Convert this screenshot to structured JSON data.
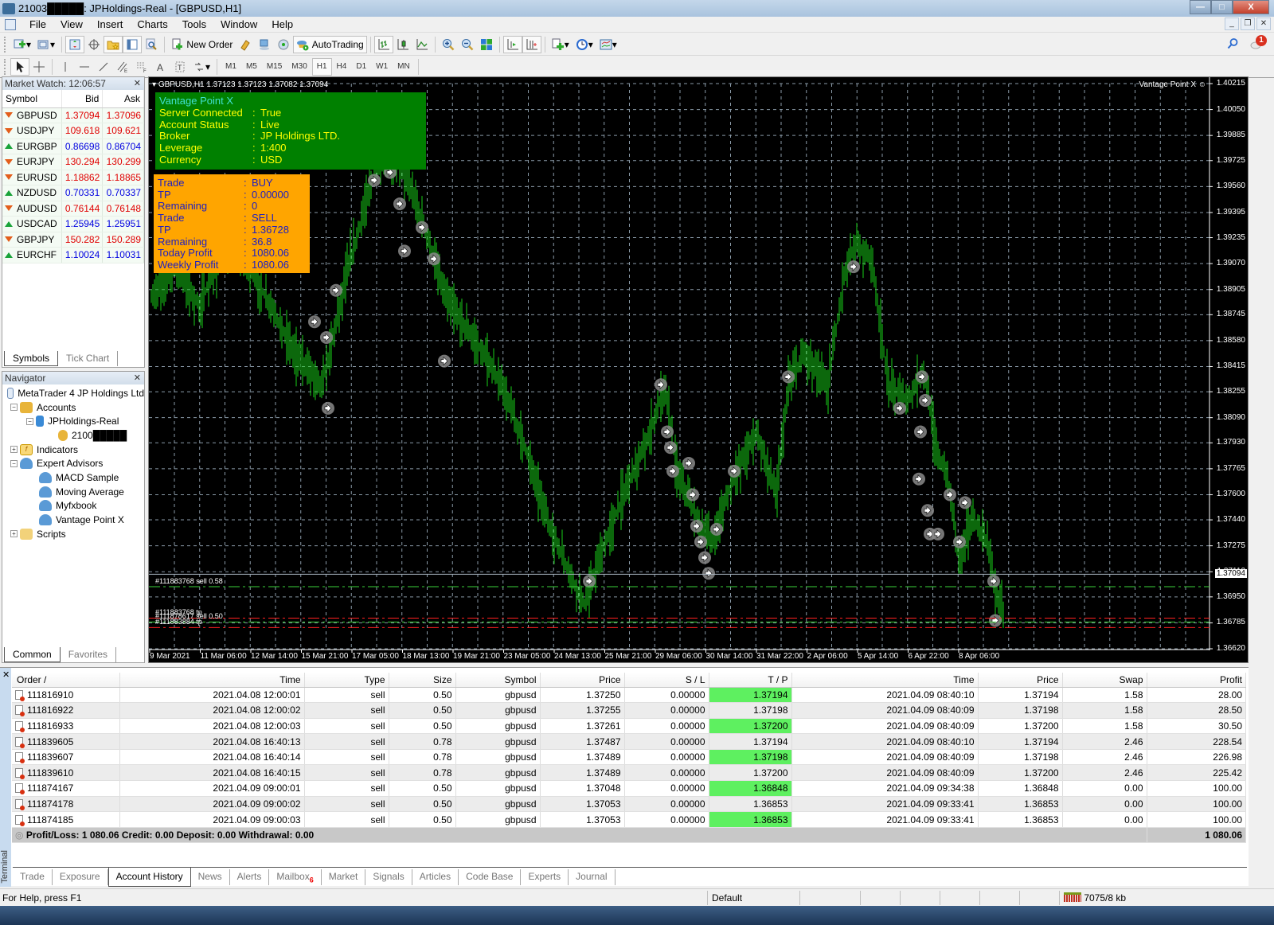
{
  "window": {
    "title": "21003█████: JPHoldings-Real - [GBPUSD,H1]",
    "controls": {
      "minimize": "—",
      "maximize": "□",
      "close": "X"
    }
  },
  "menu": [
    "File",
    "View",
    "Insert",
    "Charts",
    "Tools",
    "Window",
    "Help"
  ],
  "toolbar": {
    "new_order": "New Order",
    "autotrading": "AutoTrading",
    "timeframes": [
      "M1",
      "M5",
      "M15",
      "M30",
      "H1",
      "H4",
      "D1",
      "W1",
      "MN"
    ],
    "active_timeframe": "H1",
    "notification_count": "1"
  },
  "market_watch": {
    "title": "Market Watch: 12:06:57",
    "columns": [
      "Symbol",
      "Bid",
      "Ask"
    ],
    "rows": [
      {
        "symbol": "GBPUSD",
        "bid": "1.37094",
        "ask": "1.37096",
        "dir": "down"
      },
      {
        "symbol": "USDJPY",
        "bid": "109.618",
        "ask": "109.621",
        "dir": "down"
      },
      {
        "symbol": "EURGBP",
        "bid": "0.86698",
        "ask": "0.86704",
        "dir": "up"
      },
      {
        "symbol": "EURJPY",
        "bid": "130.294",
        "ask": "130.299",
        "dir": "down"
      },
      {
        "symbol": "EURUSD",
        "bid": "1.18862",
        "ask": "1.18865",
        "dir": "down"
      },
      {
        "symbol": "NZDUSD",
        "bid": "0.70331",
        "ask": "0.70337",
        "dir": "up"
      },
      {
        "symbol": "AUDUSD",
        "bid": "0.76144",
        "ask": "0.76148",
        "dir": "down"
      },
      {
        "symbol": "USDCAD",
        "bid": "1.25945",
        "ask": "1.25951",
        "dir": "up"
      },
      {
        "symbol": "GBPJPY",
        "bid": "150.282",
        "ask": "150.289",
        "dir": "down"
      },
      {
        "symbol": "EURCHF",
        "bid": "1.10024",
        "ask": "1.10031",
        "dir": "up"
      }
    ],
    "tabs": [
      "Symbols",
      "Tick Chart"
    ]
  },
  "navigator": {
    "title": "Navigator",
    "root": "MetaTrader 4 JP Holdings Ltd",
    "accounts": "Accounts",
    "server": "JPHoldings-Real",
    "account": "2100█████",
    "indicators": "Indicators",
    "expert_advisors": "Expert Advisors",
    "experts": [
      "MACD Sample",
      "Moving Average",
      "Myfxbook",
      "Vantage Point X"
    ],
    "scripts": "Scripts",
    "tabs": [
      "Common",
      "Favorites"
    ]
  },
  "chart": {
    "header": "GBPUSD,H1  1.37123 1.37123 1.37082 1.37094",
    "ea_name": "Vantage Point X",
    "current_price": "1.37094",
    "price_levels": [
      "1.40215",
      "1.40050",
      "1.39885",
      "1.39725",
      "1.39560",
      "1.39395",
      "1.39235",
      "1.39070",
      "1.38905",
      "1.38745",
      "1.38580",
      "1.38415",
      "1.38255",
      "1.38090",
      "1.37930",
      "1.37765",
      "1.37600",
      "1.37440",
      "1.37275",
      "1.37110",
      "1.36950",
      "1.36785",
      "1.36620"
    ],
    "time_labels": [
      "9 Mar 2021",
      "11 Mar 06:00",
      "12 Mar 14:00",
      "15 Mar 21:00",
      "17 Mar 05:00",
      "18 Mar 13:00",
      "19 Mar 21:00",
      "23 Mar 05:00",
      "24 Mar 13:00",
      "25 Mar 21:00",
      "29 Mar 06:00",
      "30 Mar 14:00",
      "31 Mar 22:00",
      "2 Apr 06:00",
      "5 Apr 14:00",
      "6 Apr 22:00",
      "8 Apr 06:00"
    ],
    "order_lines": [
      {
        "label": "#111883768 sell 0.58",
        "price": 1.37015,
        "color": "#3ad23a"
      },
      {
        "label": "#111883768 tp",
        "price": 1.36815,
        "color": "#ff2020"
      },
      {
        "label": "#111878617 sell 0.50",
        "price": 1.3679,
        "color": "#3ad23a"
      },
      {
        "label": "#111883884 tp",
        "price": 1.36755,
        "color": "#ff2020"
      }
    ],
    "colors": {
      "bars": "#19d119",
      "grid": "#8a9aa8",
      "background": "#000000"
    }
  },
  "panel_status": {
    "title": "Vantage Point X",
    "rows": [
      {
        "k": "Server Connected",
        "v": "True"
      },
      {
        "k": "Account Status",
        "v": "Live"
      },
      {
        "k": "Broker",
        "v": "JP Holdings LTD."
      },
      {
        "k": "Leverage",
        "v": "1:400"
      },
      {
        "k": "Currency",
        "v": "USD"
      }
    ]
  },
  "panel_trade": {
    "rows": [
      {
        "k": "Trade",
        "v": "BUY"
      },
      {
        "k": "TP",
        "v": "0.00000"
      },
      {
        "k": "Remaining",
        "v": "0"
      },
      {
        "k": "Trade",
        "v": "SELL"
      },
      {
        "k": "TP",
        "v": "1.36728"
      },
      {
        "k": "Remaining",
        "v": "36.8"
      },
      {
        "k": "Today Profit",
        "v": "1080.06"
      },
      {
        "k": "Weekly Profit",
        "v": "1080.06"
      }
    ]
  },
  "terminal": {
    "side_label": "Terminal",
    "columns": [
      "Order  /",
      "Time",
      "Type",
      "Size",
      "Symbol",
      "Price",
      "S / L",
      "T / P",
      "Time",
      "Price",
      "Swap",
      "Profit"
    ],
    "rows": [
      [
        "111816910",
        "2021.04.08 12:00:01",
        "sell",
        "0.50",
        "gbpusd",
        "1.37250",
        "0.00000",
        "1.37194",
        "2021.04.09 08:40:10",
        "1.37194",
        "1.58",
        "28.00"
      ],
      [
        "111816922",
        "2021.04.08 12:00:02",
        "sell",
        "0.50",
        "gbpusd",
        "1.37255",
        "0.00000",
        "1.37198",
        "2021.04.09 08:40:09",
        "1.37198",
        "1.58",
        "28.50"
      ],
      [
        "111816933",
        "2021.04.08 12:00:03",
        "sell",
        "0.50",
        "gbpusd",
        "1.37261",
        "0.00000",
        "1.37200",
        "2021.04.09 08:40:09",
        "1.37200",
        "1.58",
        "30.50"
      ],
      [
        "111839605",
        "2021.04.08 16:40:13",
        "sell",
        "0.78",
        "gbpusd",
        "1.37487",
        "0.00000",
        "1.37194",
        "2021.04.09 08:40:10",
        "1.37194",
        "2.46",
        "228.54"
      ],
      [
        "111839607",
        "2021.04.08 16:40:14",
        "sell",
        "0.78",
        "gbpusd",
        "1.37489",
        "0.00000",
        "1.37198",
        "2021.04.09 08:40:09",
        "1.37198",
        "2.46",
        "226.98"
      ],
      [
        "111839610",
        "2021.04.08 16:40:15",
        "sell",
        "0.78",
        "gbpusd",
        "1.37489",
        "0.00000",
        "1.37200",
        "2021.04.09 08:40:09",
        "1.37200",
        "2.46",
        "225.42"
      ],
      [
        "111874167",
        "2021.04.09 09:00:01",
        "sell",
        "0.50",
        "gbpusd",
        "1.37048",
        "0.00000",
        "1.36848",
        "2021.04.09 09:34:38",
        "1.36848",
        "0.00",
        "100.00"
      ],
      [
        "111874178",
        "2021.04.09 09:00:02",
        "sell",
        "0.50",
        "gbpusd",
        "1.37053",
        "0.00000",
        "1.36853",
        "2021.04.09 09:33:41",
        "1.36853",
        "0.00",
        "100.00"
      ],
      [
        "111874185",
        "2021.04.09 09:00:03",
        "sell",
        "0.50",
        "gbpusd",
        "1.37053",
        "0.00000",
        "1.36853",
        "2021.04.09 09:33:41",
        "1.36853",
        "0.00",
        "100.00"
      ]
    ],
    "summary": "Profit/Loss: 1 080.06  Credit: 0.00  Deposit: 0.00  Withdrawal: 0.00",
    "summary_total": "1 080.06",
    "tabs": [
      "Trade",
      "Exposure",
      "Account History",
      "News",
      "Alerts",
      "Mailbox",
      "Market",
      "Signals",
      "Articles",
      "Code Base",
      "Experts",
      "Journal"
    ],
    "active_tab": "Account History",
    "mailbox_count": "6"
  },
  "status": {
    "help": "For Help, press F1",
    "profile": "Default",
    "connection": "7075/8 kb"
  }
}
